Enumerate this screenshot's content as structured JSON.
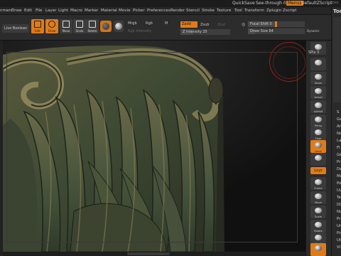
{
  "titlebar": {
    "quicksave": "QuickSave",
    "see_through": "See-through 0",
    "menus": "Menus",
    "script": "DefaultZScript"
  },
  "menus": [
    "nment",
    "Draw",
    "Edit",
    "File",
    "Layer",
    "Light",
    "Macro",
    "Marker",
    "Material",
    "Movie",
    "Picker",
    "Preferences",
    "Render",
    "Stencil",
    "Stroke",
    "Texture",
    "Tool",
    "Transform",
    "Zplugin",
    "Zscript"
  ],
  "toolbar": {
    "live_boolean": "Live Boolean",
    "tools": [
      {
        "label": "Edit",
        "active": true
      },
      {
        "label": "Draw",
        "active": true
      },
      {
        "label": "Move",
        "active": false
      },
      {
        "label": "Scale",
        "active": false
      },
      {
        "label": "Rotate",
        "active": false
      }
    ],
    "mrgb": "Mrgb",
    "rgb": "Rgb",
    "m": "M",
    "rgb_intensity": "Rgb Intensity",
    "zadd": "Zadd",
    "zsub": "Zsub",
    "zcut": "Zcut",
    "z_intensity": "Z Intensity 25",
    "z_intensity_value": 25,
    "focal_shift": "Focal Shift 0",
    "focal_shift_value": 0,
    "draw_size": "Draw Size 64",
    "draw_size_value": 64,
    "dynamic": "Dynamic"
  },
  "shelf": {
    "spix": "SPix 3",
    "buttons": [
      "",
      "Zoom",
      "Actual",
      "AAHalf",
      "Persp",
      "Floor",
      "Local",
      "",
      "Frame",
      "Move",
      "Scale",
      "Rotate",
      "PolyF",
      "Transp"
    ],
    "xyz": "Lxyz"
  },
  "tray": {
    "title": "Too",
    "items": [
      "S",
      "Ge",
      "Ar",
      "Na",
      "La",
      "Fi",
      "Ge",
      "Pr",
      "De",
      "Ma",
      "Po",
      "Uv",
      "Te",
      "Di",
      "No",
      "Pr",
      "Un",
      "Pc",
      "Ut",
      "Vi"
    ]
  },
  "colors": {
    "accent": "#e07b1a",
    "panel": "#2c2c2c",
    "canvas": "#121212",
    "orbit": "#8e2323"
  }
}
